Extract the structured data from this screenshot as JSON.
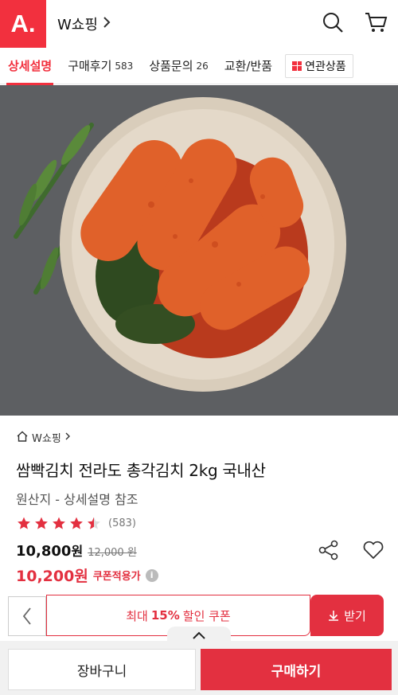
{
  "header": {
    "logo_text": "A.",
    "shop_title": "W쇼핑",
    "icons": [
      "search-icon",
      "cart-icon"
    ]
  },
  "tabs": [
    {
      "label": "상세설명",
      "count": "",
      "active": true
    },
    {
      "label": "구매후기",
      "count": "583",
      "active": false
    },
    {
      "label": "상품문의",
      "count": "26",
      "active": false
    },
    {
      "label": "교환/반품",
      "count": "",
      "active": false
    }
  ],
  "related_tab": {
    "label": "연관상품"
  },
  "product": {
    "breadcrumb": "W쇼핑",
    "name": "쌈빡김치 전라도 총각김치 2kg 국내산",
    "origin": "원산지 - 상세설명 참조",
    "rating": 4.5,
    "review_count": "(583)",
    "price": "10,800",
    "price_unit": "원",
    "original_price": "12,000 원",
    "coupon_price": "10,200원",
    "coupon_note": "쿠폰적용가"
  },
  "coupon": {
    "text_before": "최대",
    "percent": "15%",
    "text_after": "할인 쿠폰",
    "get_label": "받기"
  },
  "bottom": {
    "cart_label": "장바구니",
    "buy_label": "구매하기"
  },
  "colors": {
    "brand": "#f2303e",
    "accent": "#e33040"
  }
}
